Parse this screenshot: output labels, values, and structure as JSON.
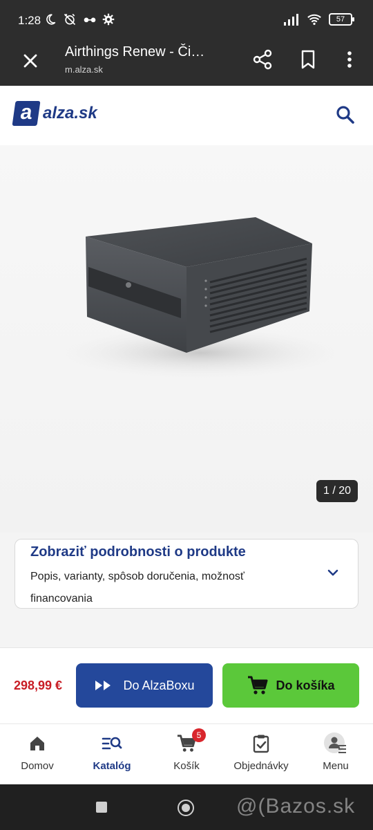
{
  "status_bar": {
    "time": "1:28",
    "battery": "57"
  },
  "browser": {
    "title": "Airthings Renew - Či…",
    "url": "m.alza.sk"
  },
  "site": {
    "logo_letter": "a",
    "logo_name": "alza.sk"
  },
  "gallery": {
    "counter": "1 / 20"
  },
  "details": {
    "title": "Zobraziť podrobnosti o produkte",
    "description": "Popis, varianty, spôsob doručenia, možnosť financovania"
  },
  "buy": {
    "price": "298,99 €",
    "alzabox_label": "Do AlzaBoxu",
    "cart_label": "Do košíka"
  },
  "nav": {
    "items": [
      {
        "label": "Domov"
      },
      {
        "label": "Katalóg"
      },
      {
        "label": "Košík",
        "badge": "5"
      },
      {
        "label": "Objednávky"
      },
      {
        "label": "Menu"
      }
    ]
  },
  "watermark": "@(Bazos.sk",
  "colors": {
    "brand_blue": "#1f3a86",
    "button_blue": "#24489b",
    "cart_green": "#5bc83a",
    "price_red": "#c81d25"
  }
}
